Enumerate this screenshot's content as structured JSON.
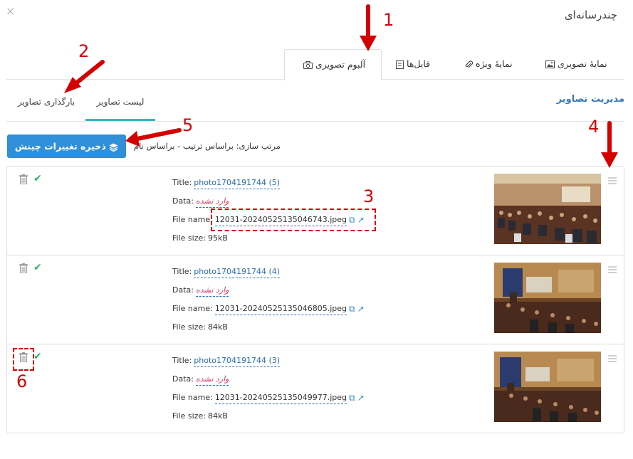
{
  "window": {
    "title": "چندرسانه‌ای",
    "close_glyph": "×"
  },
  "tabs": [
    {
      "label": "آلبوم تصویری",
      "icon": "camera-icon",
      "active": true
    },
    {
      "label": "فایل‌ها",
      "icon": "file-icon"
    },
    {
      "label": "نمایهٔ ویژه",
      "icon": "paperclip-icon"
    },
    {
      "label": "نمایهٔ تصویری",
      "icon": "image-icon"
    }
  ],
  "section_title": "مدیریت تصاویر",
  "subtabs": [
    {
      "label": "لیست تصاویر",
      "active": true
    },
    {
      "label": "بارگذاری تصاویر"
    }
  ],
  "save_button": "ذخیره تغییرات چینش",
  "sort": {
    "label": "مرتب سازی:",
    "option1": "براساس ترتیب",
    "separator": "-",
    "option2": "براساس نام"
  },
  "field_labels": {
    "title": "Title:",
    "data": "Data:",
    "file_name": "File name:",
    "file_size": "File size:"
  },
  "images": [
    {
      "title": "photo1704191744 (5)",
      "data": "وارد نشده",
      "file_name": "12031-20240525135046743.jpeg",
      "file_size": "95kB",
      "status": "approved"
    },
    {
      "title": "photo1704191744 (4)",
      "data": "وارد نشده",
      "file_name": "12031-20240525135046805.jpeg",
      "file_size": "84kB",
      "status": "approved"
    },
    {
      "title": "photo1704191744 (3)",
      "data": "وارد نشده",
      "file_name": "12031-20240525135049977.jpeg",
      "file_size": "84kB",
      "status": "approved"
    }
  ],
  "annotations": [
    "1",
    "2",
    "3",
    "4",
    "5",
    "6"
  ],
  "colors": {
    "accent": "#2f8fd8",
    "annotation": "#d40000",
    "link": "#2b6cb0",
    "check": "#2db36b",
    "tab_underline": "#3bb1c9"
  }
}
